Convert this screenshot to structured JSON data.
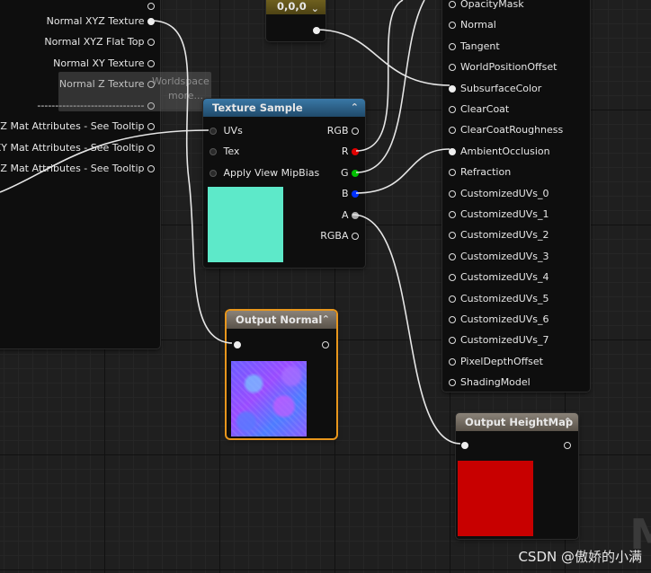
{
  "left_node": {
    "outputs": [
      "Normal XYZ Texture",
      "Normal XYZ Flat Top",
      "Normal XY Texture",
      "Normal Z Texture",
      "------------------------------",
      "XYZ Mat Attributes - See Tooltip",
      "XY Mat Attributes - See Tooltip",
      "Z Mat Attributes - See Tooltip"
    ]
  },
  "tooltip": {
    "line1": "Worldspace",
    "line2": "more..."
  },
  "const_node": {
    "title": "0,0,0"
  },
  "texture_sample": {
    "title": "Texture Sample",
    "inputs": [
      "UVs",
      "Tex",
      "Apply View MipBias"
    ],
    "outputs": [
      "RGB",
      "R",
      "G",
      "B",
      "A",
      "RGBA"
    ],
    "preview_color": "#5de9c9"
  },
  "output_normal": {
    "title": "Output Normal"
  },
  "output_heightmap": {
    "title": "Output HeightMap",
    "preview_color": "#c80000"
  },
  "material_inputs": [
    "OpacityMask",
    "Normal",
    "Tangent",
    "WorldPositionOffset",
    "SubsurfaceColor",
    "ClearCoat",
    "ClearCoatRoughness",
    "AmbientOcclusion",
    "Refraction",
    "CustomizedUVs_0",
    "CustomizedUVs_1",
    "CustomizedUVs_2",
    "CustomizedUVs_3",
    "CustomizedUVs_4",
    "CustomizedUVs_5",
    "CustomizedUVs_6",
    "CustomizedUVs_7",
    "PixelDepthOffset",
    "ShadingModel"
  ],
  "watermark": "CSDN @傲娇的小满",
  "colors": {
    "r": "#e00000",
    "g": "#00c000",
    "b": "#0030ff",
    "accent_orange": "#e8961c",
    "tex_head": "#2a5f86"
  }
}
